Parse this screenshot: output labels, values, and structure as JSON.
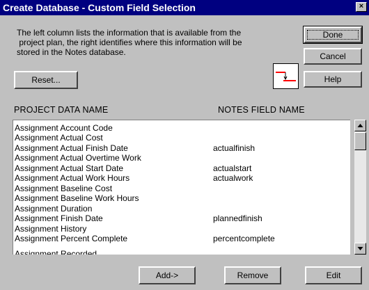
{
  "window": {
    "title": "Create Database - Custom Field Selection",
    "close_glyph": "×"
  },
  "description": {
    "lines": [
      "The left column lists the information that is available from the",
      " project plan, the right identifies where this information will be",
      "stored in the Notes database."
    ]
  },
  "buttons": {
    "done": "Done",
    "cancel": "Cancel",
    "help": "Help",
    "reset": "Reset...",
    "add": "Add->",
    "remove": "Remove",
    "edit": "Edit"
  },
  "columns": {
    "project": "PROJECT DATA NAME",
    "notes": "NOTES FIELD NAME"
  },
  "rows": [
    {
      "project": "Assignment Account Code",
      "notes": ""
    },
    {
      "project": "Assignment Actual Cost",
      "notes": ""
    },
    {
      "project": "Assignment Actual Finish Date",
      "notes": "actualfinish"
    },
    {
      "project": "Assignment Actual Overtime Work",
      "notes": ""
    },
    {
      "project": "Assignment Actual Start Date",
      "notes": "actualstart"
    },
    {
      "project": "Assignment Actual Work Hours",
      "notes": "actualwork"
    },
    {
      "project": "Assignment Baseline Cost",
      "notes": ""
    },
    {
      "project": "Assignment Baseline Work Hours",
      "notes": ""
    },
    {
      "project": "Assignment Duration",
      "notes": ""
    },
    {
      "project": "Assignment Finish Date",
      "notes": "plannedfinish"
    },
    {
      "project": "Assignment History",
      "notes": ""
    },
    {
      "project": "Assignment Percent Complete",
      "notes": "percentcomplete"
    },
    {
      "project": "Assignment Recorded...",
      "notes": ""
    }
  ],
  "icons": {
    "mapping": "field-mapping-icon",
    "scroll_up": "scroll-up-arrow-icon",
    "scroll_down": "scroll-down-arrow-icon"
  },
  "colors": {
    "titlebar": "#000080",
    "face": "#c0c0c0",
    "icon_red": "#ff0000"
  }
}
